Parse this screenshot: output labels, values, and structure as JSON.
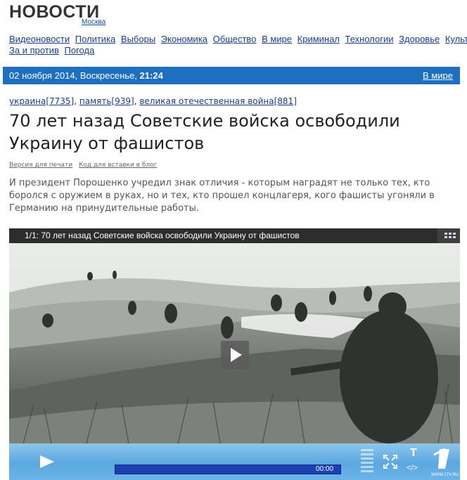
{
  "header": {
    "logo": "НОВОСТИ",
    "city": "Москва"
  },
  "nav": {
    "row1": [
      "Видеоновости",
      "Политика",
      "Выборы",
      "Экономика",
      "Общество",
      "В мире",
      "Криминал",
      "Технологии",
      "Здоровье",
      "Культура"
    ],
    "row2": [
      "За и против",
      "Погода"
    ]
  },
  "datebar": {
    "date": "02 ноября 2014, Воскресенье,",
    "time": "21:24",
    "section": "В мире"
  },
  "tags": [
    {
      "label": "украина[7735]"
    },
    {
      "label": "память[939]"
    },
    {
      "label": "великая отечественная война[881]"
    }
  ],
  "article": {
    "title": "70 лет назад Советские войска освободили Украину от фашистов",
    "print_link": "Версия для печати",
    "embed_link": "Код для вставки в блог",
    "lead": "И президент Порошенко учредил знак отличия - которым наградят не только тех, кто боролся с оружием в руках, но и тех, кто прошел концлагеря, кого фашисты угоняли в Германию на принудительные работы."
  },
  "player": {
    "title": "1/1: 70 лет назад Советские войска освободили Украину от фашистов",
    "time": "00:00",
    "text_button": "T",
    "embed_button": "</>",
    "channel_site": "WWW.1TV.RU",
    "icons": {
      "playlist": "grid-icon",
      "play": "play-icon",
      "volume": "volume-icon",
      "fullscreen": "fullscreen-icon",
      "channel": "channel-one-logo"
    }
  }
}
